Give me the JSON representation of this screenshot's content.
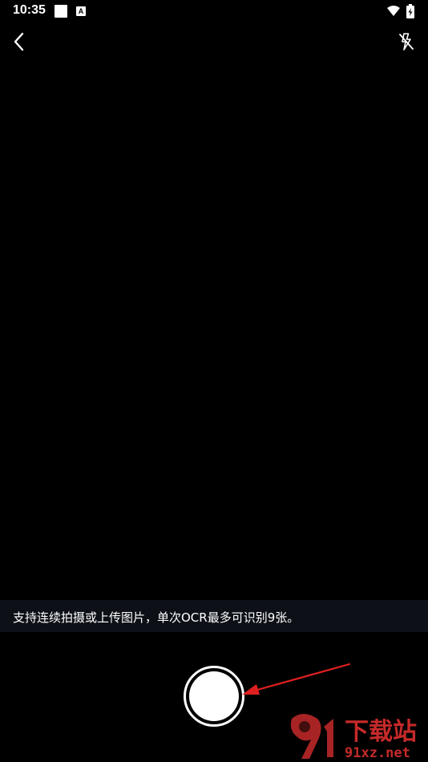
{
  "status_bar": {
    "time": "10:35",
    "icons": [
      "notification-square-icon",
      "a-badge-icon",
      "wifi-icon",
      "battery-charging-icon"
    ],
    "badge_letter": "A"
  },
  "top_bar": {
    "back_icon": "chevron-left-icon",
    "flash_icon": "flash-off-icon"
  },
  "hint": {
    "text": "支持连续拍摄或上传图片，单次OCR最多可识别9张。"
  },
  "shutter": {
    "icon": "shutter-icon"
  },
  "annotation": {
    "arrow_color": "#e02020"
  },
  "watermark": {
    "main_text": "下载站",
    "sub_text": "91xz.net",
    "color": "#c62a2a"
  },
  "colors": {
    "background": "#000000",
    "hint_bg": "#0d1117",
    "accent": "#ffffff"
  }
}
